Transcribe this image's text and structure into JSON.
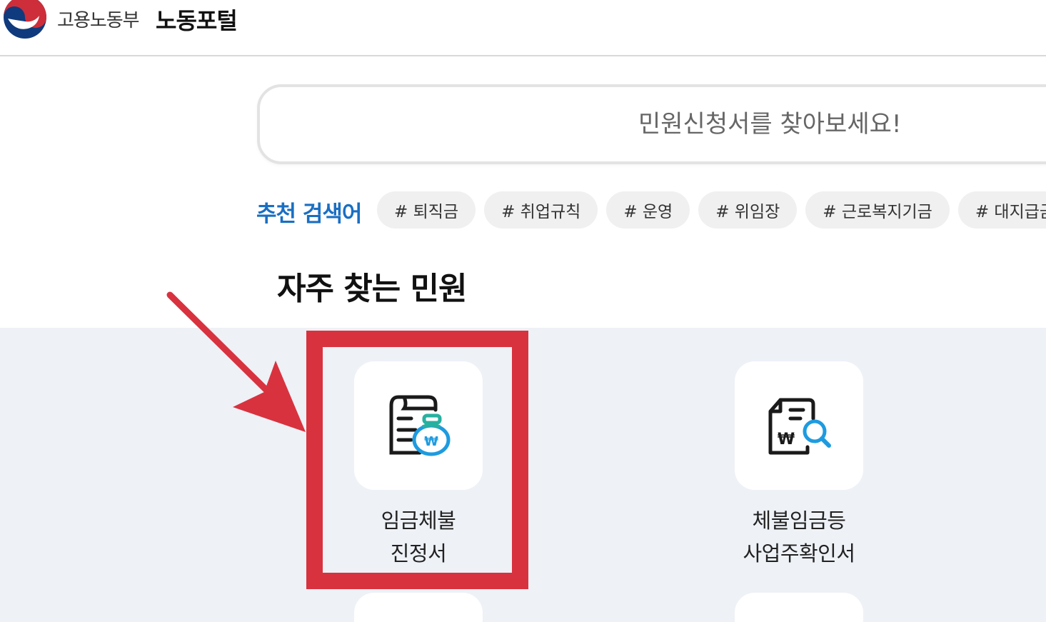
{
  "header": {
    "ministry": "고용노동부",
    "portal": "노동포털",
    "colors": {
      "emblem_red": "#cd2e3a",
      "emblem_blue": "#0f3a7d"
    }
  },
  "search": {
    "placeholder": "민원신청서를 찾아보세요!"
  },
  "recommend": {
    "label": "추천 검색어",
    "tags": [
      "# 퇴직금",
      "# 취업규칙",
      "# 운영",
      "# 위임장",
      "# 근로복지기금",
      "# 대지급금"
    ]
  },
  "section": {
    "title": "자주 찾는 민원"
  },
  "cards": [
    {
      "line1": "임금체불",
      "line2": "진정서",
      "icon": "wage-bag-document-icon"
    },
    {
      "line1": "체불임금등",
      "line2": "사업주확인서",
      "icon": "document-search-icon"
    }
  ],
  "annotation": {
    "highlight_color": "#d8323f"
  }
}
